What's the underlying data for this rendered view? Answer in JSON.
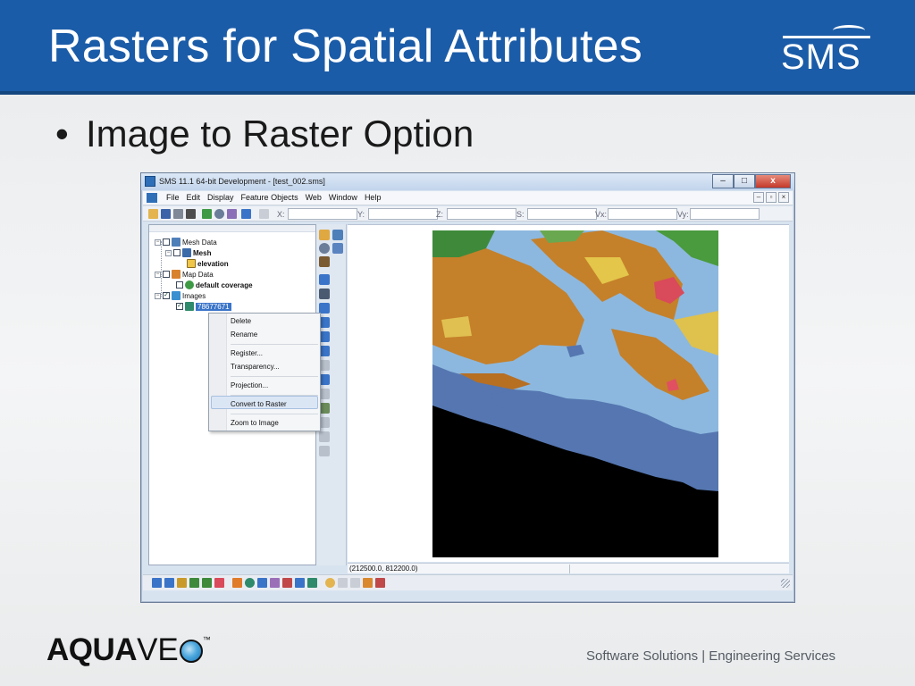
{
  "slide": {
    "title": "Rasters for Spatial Attributes",
    "logo_text": "SMS",
    "bullet": "Image to Raster Option",
    "footer_brand_bold": "AQUA",
    "footer_brand_light": "VE",
    "footer_trademark": "™",
    "tagline": "Software Solutions | Engineering Services"
  },
  "window": {
    "title": "SMS 11.1 64-bit Development - [test_002.sms]",
    "minimize": "–",
    "maximize": "□",
    "close": "x"
  },
  "menu": {
    "items": [
      "File",
      "Edit",
      "Display",
      "Feature Objects",
      "Web",
      "Window",
      "Help"
    ],
    "mdi_min": "–",
    "mdi_restore": "▫",
    "mdi_close": "×"
  },
  "toolbar": {
    "labels": {
      "x": "X:",
      "y": "Y:",
      "z": "Z:",
      "s": "S:",
      "vx": "Vx:",
      "vy": "Vy:"
    }
  },
  "tree": {
    "mesh_data": "Mesh Data",
    "mesh": "Mesh",
    "elevation": "elevation",
    "map_data": "Map Data",
    "default_coverage": "default coverage",
    "images": "Images",
    "image_item": "78677671"
  },
  "context_menu": {
    "items": [
      "Delete",
      "Rename",
      "Register...",
      "Transparency...",
      "Projection...",
      "Convert to Raster",
      "Zoom to Image"
    ],
    "highlighted": "Convert to Raster"
  },
  "status": {
    "coords": "(212500.0, 812200.0)"
  },
  "colors": {
    "header_blue": "#1b5ca8",
    "selection_blue": "#3a74c8",
    "land_orange": "#c5802a",
    "water_blue": "#8cb8df",
    "ocean_blue": "#5576b0"
  }
}
